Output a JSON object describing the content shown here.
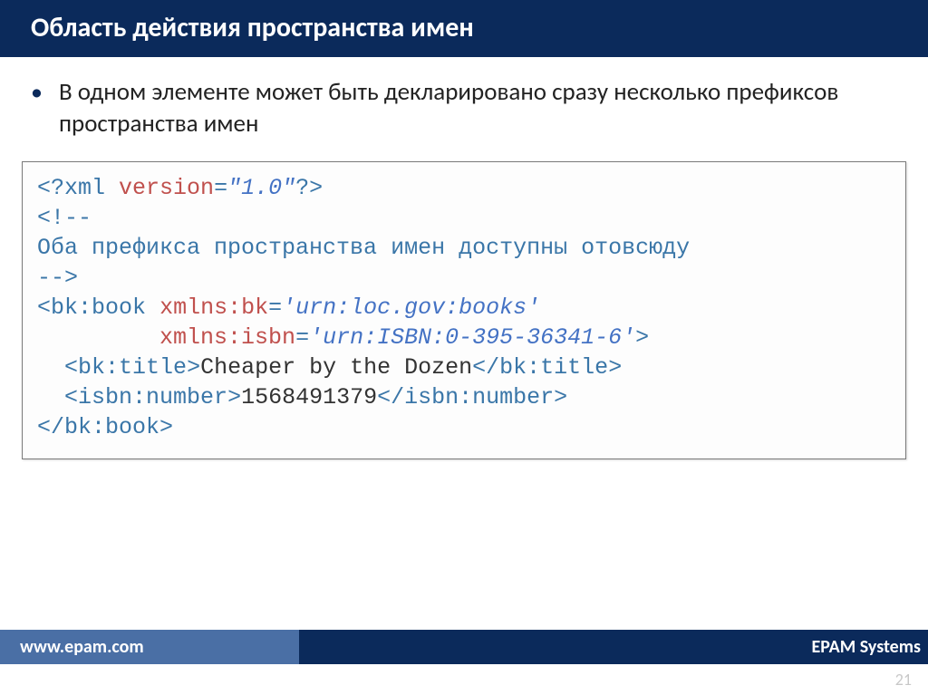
{
  "header": {
    "title": "Область действия пространства имен"
  },
  "body": {
    "bullets": [
      "В одном элементе может быть декларировано сразу несколько префиксов пространства имен"
    ]
  },
  "code": {
    "l1": {
      "a": "xml",
      "b": "version",
      "c": "\"1.0\""
    },
    "comment": "Оба префикса пространства имен доступны отовсюду",
    "open": {
      "tag": "bk:book",
      "a1n": "xmlns:bk",
      "a1v": "'urn:loc.gov:books'",
      "a2n": "xmlns:isbn",
      "a2v": "'urn:ISBN:0-395-36341-6'"
    },
    "title": {
      "tag": "bk:title",
      "text": "Cheaper by the Dozen"
    },
    "number": {
      "tag": "isbn:number",
      "text": "1568491379"
    }
  },
  "footer": {
    "url": "www.epam.com",
    "brand": "EPAM Systems",
    "page": "21"
  }
}
